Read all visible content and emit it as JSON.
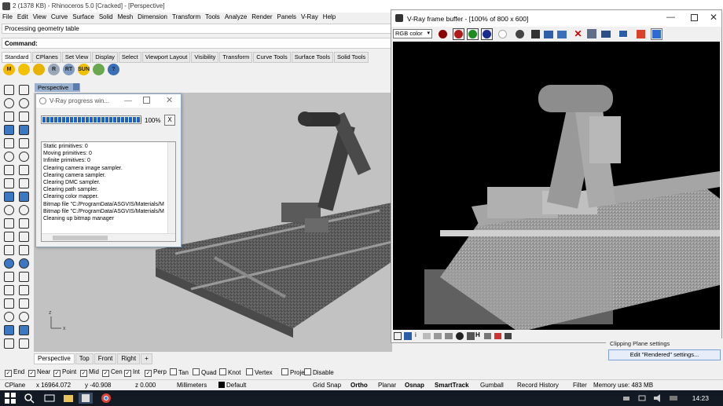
{
  "rhino": {
    "title": "2 (1378 KB) - Rhinoceros 5.0 [Cracked] - [Perspective]",
    "menu": [
      "File",
      "Edit",
      "View",
      "Curve",
      "Surface",
      "Solid",
      "Mesh",
      "Dimension",
      "Transform",
      "Tools",
      "Analyze",
      "Render",
      "Panels",
      "V-Ray",
      "Help"
    ],
    "command_history": "Processing geometry table",
    "command_label": "Command:",
    "toolbar_tabs": [
      "Standard",
      "CPlanes",
      "Set View",
      "Display",
      "Select",
      "Viewport Layout",
      "Visibility",
      "Transform",
      "Curve Tools",
      "Surface Tools",
      "Solid Tools"
    ],
    "std_icons": [
      {
        "icon": "vray-m-icon",
        "label": "M",
        "color": "#f2b900"
      },
      {
        "icon": "vray-object-icon",
        "label": "",
        "color": "#f2c200"
      },
      {
        "icon": "vray-light-icon",
        "label": "",
        "color": "#e8b300"
      },
      {
        "icon": "vray-render-icon",
        "label": "R",
        "color": "#9aa7b8"
      },
      {
        "icon": "vray-rt-icon",
        "label": "RT",
        "color": "#7f9bc0"
      },
      {
        "icon": "vray-sun-icon",
        "label": "SUN",
        "color": "#f0c000"
      },
      {
        "icon": "vray-fur-icon",
        "label": "",
        "color": "#6aa84f"
      },
      {
        "icon": "vray-help-icon",
        "label": "?",
        "color": "#3b6fb6"
      }
    ]
  },
  "viewport": {
    "name": "Perspective",
    "tabs": [
      "Perspective",
      "Top",
      "Front",
      "Right"
    ],
    "add_tab": "+",
    "axis_x": "x",
    "axis_z": "z"
  },
  "progress_dialog": {
    "title": "V-Ray progress win...",
    "percent_text": "100%",
    "progress": 1.0,
    "close_btn": "X",
    "log": [
      "Static primitives: 0",
      "Moving primitives: 0",
      "Infinite primitives: 0",
      "Clearing camera image sampler.",
      "Clearing camera sampler.",
      "Clearing DMC sampler.",
      "Clearing path sampler.",
      "Clearing color mapper.",
      "Bitmap file \"C:/ProgramData/ASGVIS/Materials/M",
      "Bitmap file \"C:/ProgramData/ASGVIS/Materials/M",
      "Cleaning up bitmap manager"
    ]
  },
  "vfb": {
    "title": "V-Ray frame buffer - [100% of 800 x 600]",
    "channel": "RGB color",
    "bottom_toolbar_text": "H"
  },
  "right_panel": {
    "clipping_label": "Clipping Plane settings",
    "rendered_button": "Edit \"Rendered\" settings..."
  },
  "osnap": [
    {
      "label": "End",
      "checked": true
    },
    {
      "label": "Near",
      "checked": true
    },
    {
      "label": "Point",
      "checked": true
    },
    {
      "label": "Mid",
      "checked": true
    },
    {
      "label": "Cen",
      "checked": true
    },
    {
      "label": "Int",
      "checked": true
    },
    {
      "label": "Perp",
      "checked": true
    },
    {
      "label": "Tan",
      "checked": false
    },
    {
      "label": "Quad",
      "checked": false
    },
    {
      "label": "Knot",
      "checked": false
    },
    {
      "label": "Vertex",
      "checked": false
    },
    {
      "label": "Project",
      "checked": false
    },
    {
      "label": "Disable",
      "checked": false
    }
  ],
  "status": {
    "cplane": "CPlane",
    "x": "x 16964.072",
    "y": "y -40.908",
    "z": "z 0.000",
    "units": "Millimeters",
    "layer": "Default",
    "grid_snap": "Grid Snap",
    "ortho": "Ortho",
    "planar": "Planar",
    "osnap": "Osnap",
    "smarttrack": "SmartTrack",
    "gumball": "Gumball",
    "record_history": "Record History",
    "filter": "Filter",
    "memory": "Memory use: 483 MB"
  },
  "taskbar": {
    "time": "14:23"
  }
}
